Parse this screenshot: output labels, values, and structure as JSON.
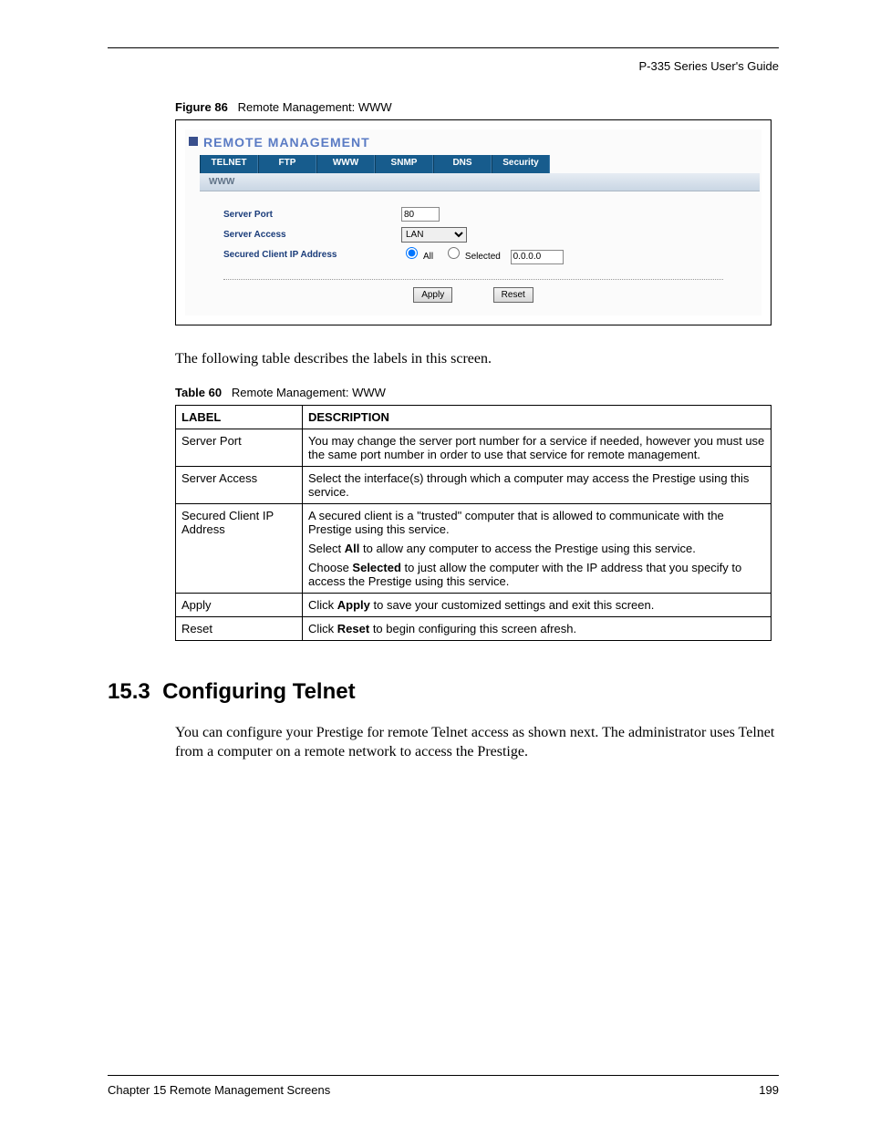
{
  "running_head": "P-335 Series User's Guide",
  "figure": {
    "num": "Figure 86",
    "title": "Remote Management: WWW"
  },
  "shot": {
    "panel_title": "REMOTE MANAGEMENT",
    "tabs": [
      "TELNET",
      "FTP",
      "WWW",
      "SNMP",
      "DNS",
      "Security"
    ],
    "sub_bar": "WWW",
    "labels": {
      "server_port": "Server Port",
      "server_access": "Server Access",
      "secured_client": "Secured Client IP Address"
    },
    "values": {
      "server_port": "80",
      "server_access": "LAN",
      "radio_all": "All",
      "radio_selected": "Selected",
      "ip": "0.0.0.0"
    },
    "buttons": {
      "apply": "Apply",
      "reset": "Reset"
    }
  },
  "intro_text": "The following table describes the labels in this screen.",
  "table_caption": {
    "num": "Table 60",
    "title": "Remote Management: WWW"
  },
  "table": {
    "headers": {
      "label": "LABEL",
      "desc": "DESCRIPTION"
    },
    "rows": [
      {
        "label": "Server Port",
        "desc": [
          "You may change the server port number for a service if needed, however you must use the same port number in order to use that service for remote management."
        ]
      },
      {
        "label": "Server Access",
        "desc": [
          "Select the interface(s) through which a computer may access the Prestige using this service."
        ]
      },
      {
        "label": "Secured Client IP Address",
        "desc_parts": [
          {
            "t": "A secured client is a \"trusted\" computer that is allowed to communicate with the Prestige using this service."
          },
          {
            "pre": "Select ",
            "b": "All",
            "post": " to allow any computer to access the Prestige using this service."
          },
          {
            "pre": "Choose ",
            "b": "Selected",
            "post": " to just allow the computer with the IP address that you specify to access the Prestige using this service."
          }
        ]
      },
      {
        "label": "Apply",
        "desc_parts": [
          {
            "pre": "Click ",
            "b": "Apply",
            "post": " to save your customized settings and exit this screen."
          }
        ]
      },
      {
        "label": "Reset",
        "desc_parts": [
          {
            "pre": "Click ",
            "b": "Reset",
            "post": " to begin configuring this screen afresh."
          }
        ]
      }
    ]
  },
  "section": {
    "num": "15.3",
    "title": "Configuring Telnet"
  },
  "section_body": "You can configure your Prestige for remote Telnet access as shown next. The administrator uses Telnet from a computer on a remote network to access the Prestige.",
  "footer": {
    "chapter": "Chapter 15 Remote Management Screens",
    "page": "199"
  }
}
